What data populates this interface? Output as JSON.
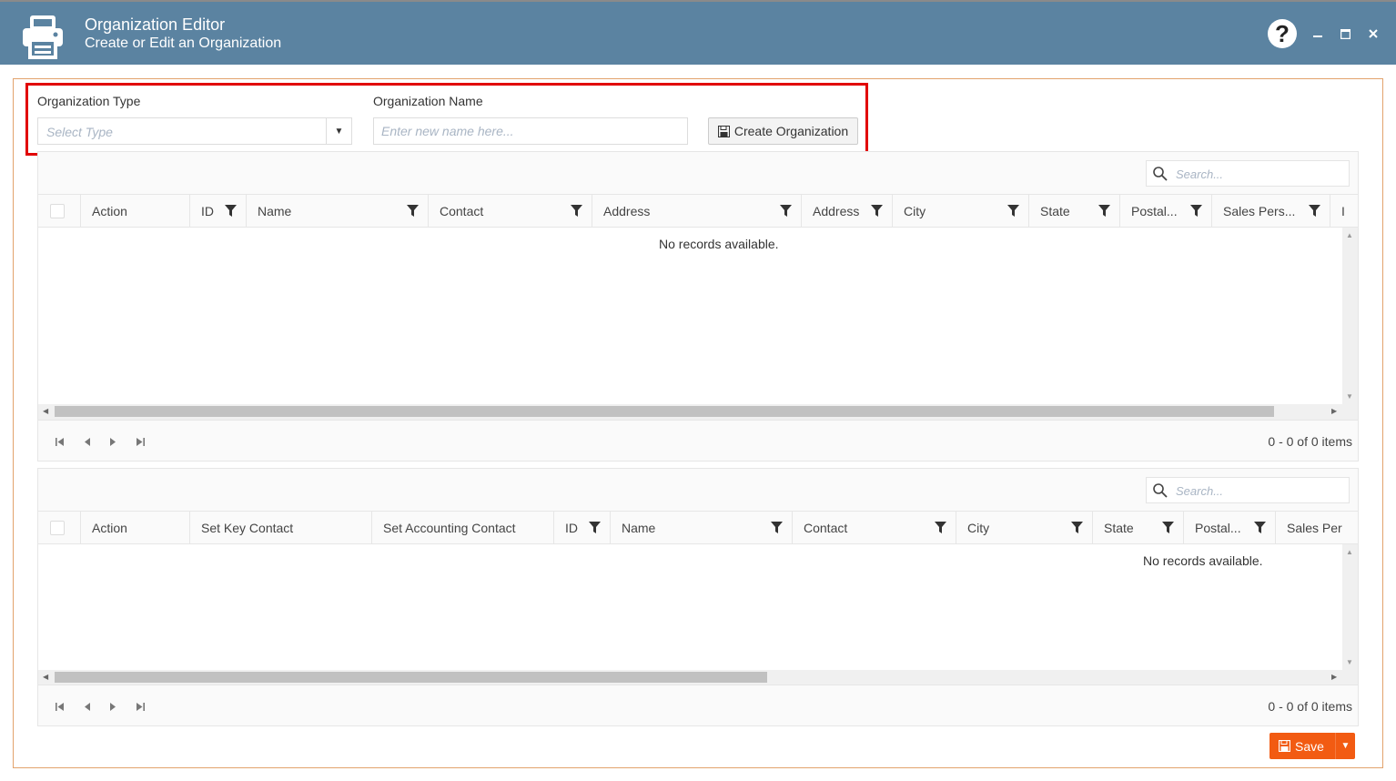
{
  "window": {
    "title": "Organization Editor",
    "subtitle": "Create or Edit an Organization",
    "help_label": "?"
  },
  "form": {
    "org_type_label": "Organization Type",
    "org_type_placeholder": "Select Type",
    "org_name_label": "Organization Name",
    "org_name_placeholder": "Enter new name here...",
    "create_button": "Create Organization"
  },
  "grid1": {
    "search_placeholder": "Search...",
    "columns": [
      "Action",
      "ID",
      "Name",
      "Contact",
      "Address",
      "Address",
      "City",
      "State",
      "Postal...",
      "Sales Pers...",
      "I"
    ],
    "empty_text": "No records available.",
    "pager_info": "0 - 0 of 0 items"
  },
  "grid2": {
    "search_placeholder": "Search...",
    "columns": [
      "Action",
      "Set Key Contact",
      "Set Accounting Contact",
      "ID",
      "Name",
      "Contact",
      "City",
      "State",
      "Postal...",
      "Sales Per"
    ],
    "empty_text": "No records available.",
    "pager_info": "0 - 0 of 0 items"
  },
  "footer": {
    "save_label": "Save"
  },
  "colors": {
    "titlebar": "#5b83a1",
    "frame_border": "#e2a36d",
    "highlight": "#e10000",
    "save": "#f25b12"
  }
}
